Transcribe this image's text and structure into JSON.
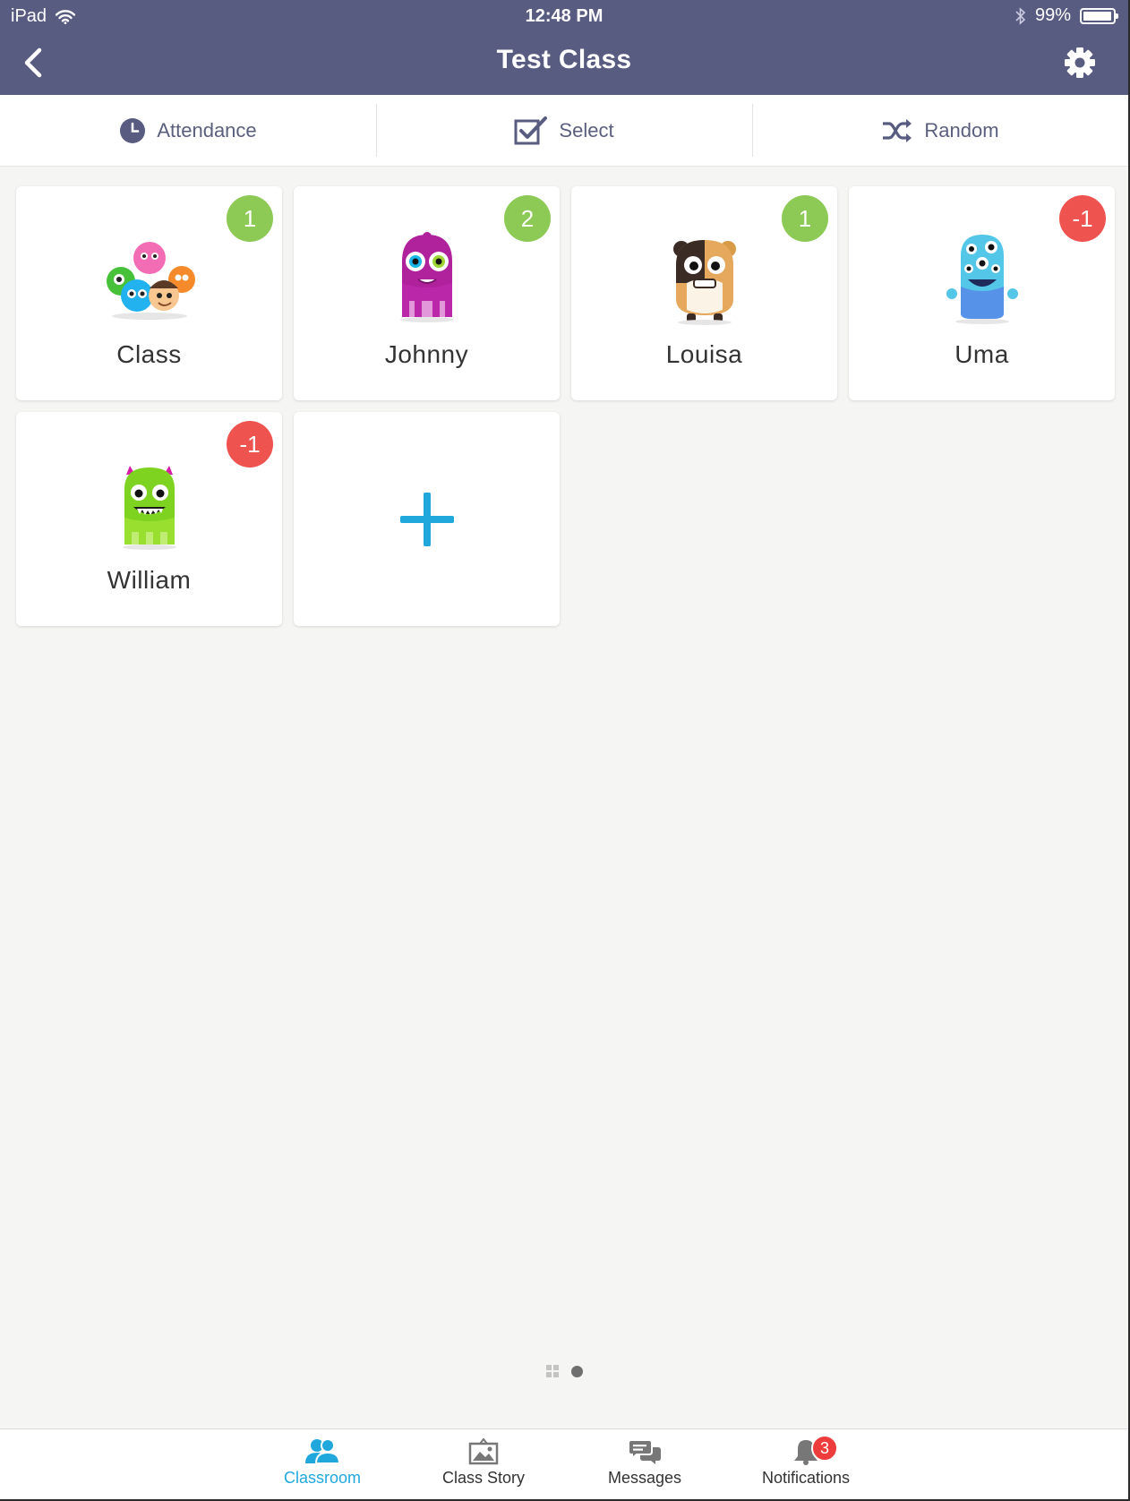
{
  "status_bar": {
    "device": "iPad",
    "time": "12:48 PM",
    "battery": "99%"
  },
  "nav": {
    "title": "Test Class"
  },
  "toolbar": {
    "attendance_label": "Attendance",
    "select_label": "Select",
    "random_label": "Random"
  },
  "students": [
    {
      "name": "Class",
      "points": "1",
      "avatar": "class-group-avatar-icon"
    },
    {
      "name": "Johnny",
      "points": "2",
      "avatar": "purple-monster-avatar-icon"
    },
    {
      "name": "Louisa",
      "points": "1",
      "avatar": "hamster-monster-avatar-icon"
    },
    {
      "name": "Uma",
      "points": "-1",
      "avatar": "blue-multi-eye-monster-avatar-icon"
    },
    {
      "name": "William",
      "points": "-1",
      "avatar": "green-monster-avatar-icon"
    }
  ],
  "tabs": {
    "classroom": "Classroom",
    "class_story": "Class Story",
    "messages": "Messages",
    "notifications": "Notifications",
    "notifications_count": "3"
  },
  "colors": {
    "header": "#585c80",
    "positive": "#8dc955",
    "negative": "#ef5350",
    "accent": "#20a8dd",
    "toolbar_text": "#5b5f7e"
  }
}
